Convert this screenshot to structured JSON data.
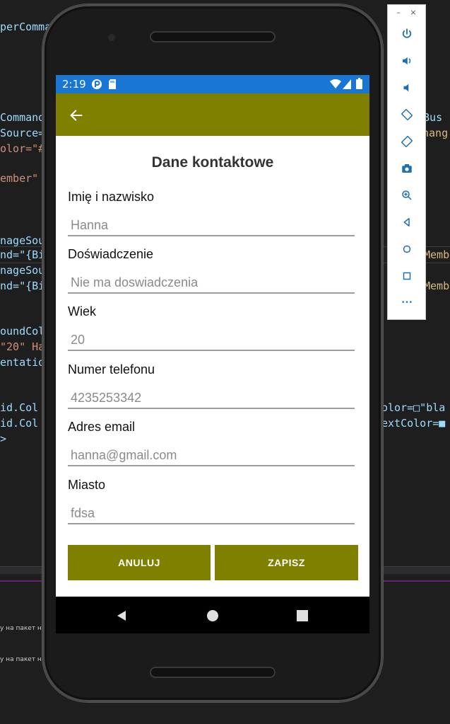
{
  "editor": {
    "left_lines": [
      "perComma",
      "Command",
      "Source=",
      "olor=\"#",
      "ember\"",
      "nageSou",
      "nd=\"{Bi",
      "nageSou",
      "nd=\"{Bi",
      "oundCol",
      "\"20\" Ha",
      "entatio",
      "id.Col",
      "id.Col",
      ">"
    ],
    "right_lines": [
      "sBus",
      "hang",
      "Memb",
      "Memb",
      "olor=□\"bla",
      "extColor=■"
    ],
    "status_left_1": "у на пакет на",
    "status_left_2": "у на пакет на"
  },
  "emulator_toolbar": {
    "minimize": "–",
    "close": "×",
    "buttons": [
      "power-icon",
      "volume-up-icon",
      "volume-down-icon",
      "rotate-left-icon",
      "rotate-right-icon",
      "camera-icon",
      "zoom-icon",
      "back-icon",
      "home-icon",
      "overview-icon",
      "more-icon"
    ],
    "more_label": "•••"
  },
  "status_bar": {
    "time": "2:19"
  },
  "form": {
    "title": "Dane kontaktowe",
    "fields": [
      {
        "label": "Imię i nazwisko",
        "value": "Hanna"
      },
      {
        "label": "Doświadczenie",
        "value": "Nie ma doswiadczenia"
      },
      {
        "label": "Wiek",
        "value": "20"
      },
      {
        "label": "Numer telefonu",
        "value": "4235253342"
      },
      {
        "label": "Adres email",
        "value": "hanna@gmail.com"
      },
      {
        "label": "Miasto",
        "value": "fdsa"
      }
    ],
    "cancel_label": "ANULUJ",
    "save_label": "ZAPISZ"
  },
  "colors": {
    "accent": "#808000",
    "status_bar": "#1976d2"
  }
}
